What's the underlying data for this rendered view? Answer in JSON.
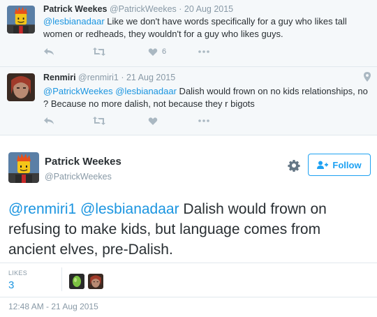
{
  "conversation": [
    {
      "name": "Patrick Weekes",
      "handle": "@PatrickWeekes",
      "separator": " · ",
      "date": "20 Aug 2015",
      "mention": "@lesbianadaar",
      "text": " Like we don't have words specifically for a guy who likes tall women or redheads, they wouldn't for a guy who likes guys.",
      "like_count": "6"
    },
    {
      "name": "Renmiri",
      "handle": "@renmiri1",
      "separator": " · ",
      "date": "21 Aug 2015",
      "mention1": "@PatrickWeekes",
      "mention2": "@lesbianadaar",
      "text": " Dalish would frown on no kids relationships, no ? Because no more dalish, not because they r bigots"
    }
  ],
  "main_tweet": {
    "name": "Patrick Weekes",
    "handle": "@PatrickWeekes",
    "follow_label": "Follow",
    "mention1": "@renmiri1",
    "mention2": "@lesbianadaar",
    "text": " Dalish would frown on refusing to make kids, but language comes from ancient elves, pre-Dalish.",
    "likes_label": "LIKES",
    "likes_count": "3",
    "timestamp": "12:48 AM - 21 Aug 2015"
  },
  "icons": [
    "reply-icon",
    "retweet-icon",
    "like-icon",
    "more-icon",
    "location-icon",
    "gear-icon",
    "follow-icon"
  ],
  "colors": {
    "link": "#1b95e0",
    "accent": "#1da1f2",
    "muted": "#8899a6",
    "text": "#292f33",
    "conversation_bg": "#f5f8fa"
  }
}
